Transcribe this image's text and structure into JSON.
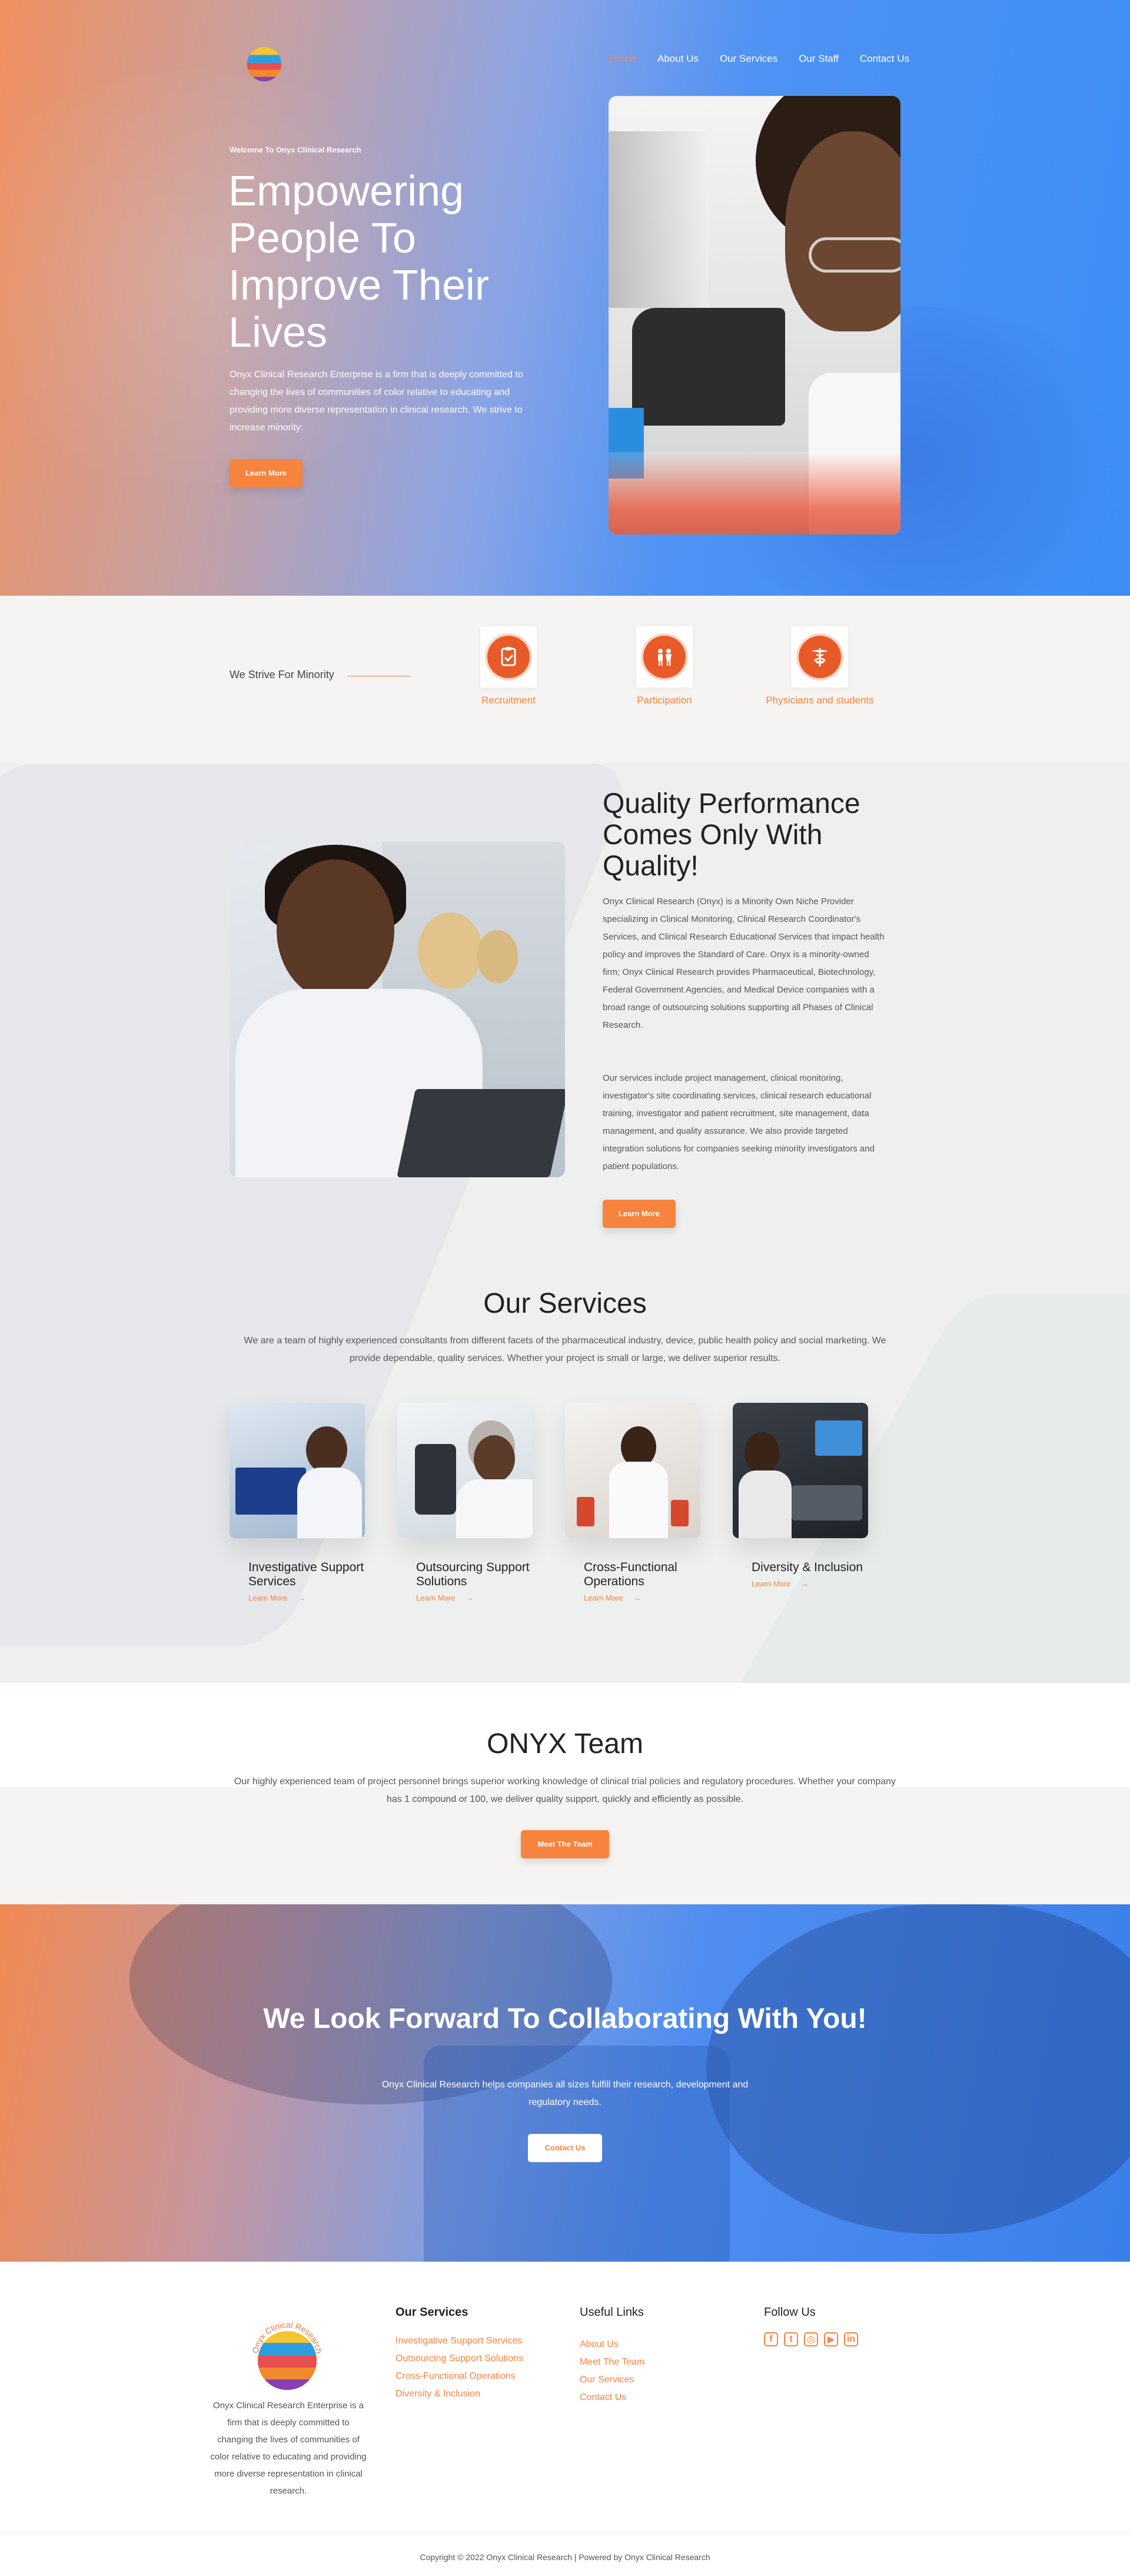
{
  "colors": {
    "accent": "#f6833e",
    "hero_blue": "#3d8df5",
    "hero_orange": "#f09060",
    "icon_orange": "#e85a27"
  },
  "nav": {
    "items": [
      {
        "label": "Home",
        "active": true
      },
      {
        "label": "About Us"
      },
      {
        "label": "Our Services"
      },
      {
        "label": "Our Staff"
      },
      {
        "label": "Contact Us"
      }
    ]
  },
  "hero": {
    "kicker": "Welcome To Onyx Clinical Research",
    "title": "Empowering People To Improve Their Lives",
    "description": "Onyx Clinical Research Enterprise is a firm that is deeply committed to changing the lives of communities of color relative to educating and providing more diverse representation in clinical research. We strive to increase minority:",
    "button": "Learn More"
  },
  "strive": {
    "label": "We Strive For Minority",
    "features": [
      {
        "label": "Recruitment",
        "icon": "clipboard-check-icon"
      },
      {
        "label": "Participation",
        "icon": "people-icon"
      },
      {
        "label": "Physicians and students",
        "icon": "caduceus-icon"
      }
    ]
  },
  "about": {
    "title": "Quality Performance Comes Only With Quality!",
    "paragraph1": "Onyx Clinical Research (Onyx) is a Minority Own Niche Provider specializing in Clinical Monitoring, Clinical Research Coordinator's Services, and Clinical Research Educational Services that impact health policy and improves the Standard of Care. Onyx is a minority-owned firm; Onyx Clinical Research provides Pharmaceutical, Biotechnology, Federal Government Agencies, and Medical Device companies with a broad range of outsourcing solutions supporting all Phases of Clinical Research.",
    "paragraph2": "Our services include project management, clinical monitoring, investigator's site coordinating services, clinical research educational training, investigator and patient recruitment, site management, data management, and quality assurance. We also provide targeted integration solutions for companies seeking minority investigators and patient populations.",
    "button": "Learn More"
  },
  "services": {
    "title": "Our Services",
    "description": "We are a team of highly experienced consultants from different facets of the pharmaceutical industry, device, public health policy and social marketing. We provide dependable, quality services. Whether your project is small or large, we deliver superior results.",
    "cards": [
      {
        "title": "Investigative Support Services",
        "link": "Learn More",
        "arrow": "→"
      },
      {
        "title": "Outsourcing Support Solutions",
        "link": "Learn More",
        "arrow": "→"
      },
      {
        "title": "Cross-Functional Operations",
        "link": "Learn More",
        "arrow": "→"
      },
      {
        "title": "Diversity & Inclusion",
        "link": "Learn More",
        "arrow": "→"
      }
    ]
  },
  "team": {
    "title": "ONYX Team",
    "description": "Our highly experienced team of project personnel brings superior working knowledge of clinical trial policies and regulatory procedures. Whether your company has 1 compound or 100, we deliver quality support, quickly and efficiently as possible.",
    "button": "Meet The Team"
  },
  "cta": {
    "title": "We Look Forward To Collaborating With You!",
    "description": "Onyx Clinical Research helps companies all sizes fulfill their research, development and regulatory needs.",
    "button": "Contact Us"
  },
  "footer": {
    "logo_text": "Onyx Clinical Research",
    "about": "Onyx Clinical Research Enterprise is a firm that is deeply committed to changing the lives of communities of color relative to educating and providing more diverse representation in clinical research.",
    "services_heading": "Our Services",
    "services_links": [
      "Investigative Support Services",
      "Outsourcing Support Solutions",
      "Cross-Functional Operations",
      "Diversity & Inclusion"
    ],
    "useful_heading": "Useful Links",
    "useful_links": [
      "About Us",
      "Meet The Team",
      "Our Services",
      "Contact Us"
    ],
    "follow_heading": "Follow Us",
    "social_icons": [
      "facebook-icon",
      "twitter-icon",
      "instagram-icon",
      "youtube-icon",
      "linkedin-icon"
    ],
    "copyright": "Copyright © 2022 Onyx Clinical Research | Powered by Onyx Clinical Research"
  }
}
